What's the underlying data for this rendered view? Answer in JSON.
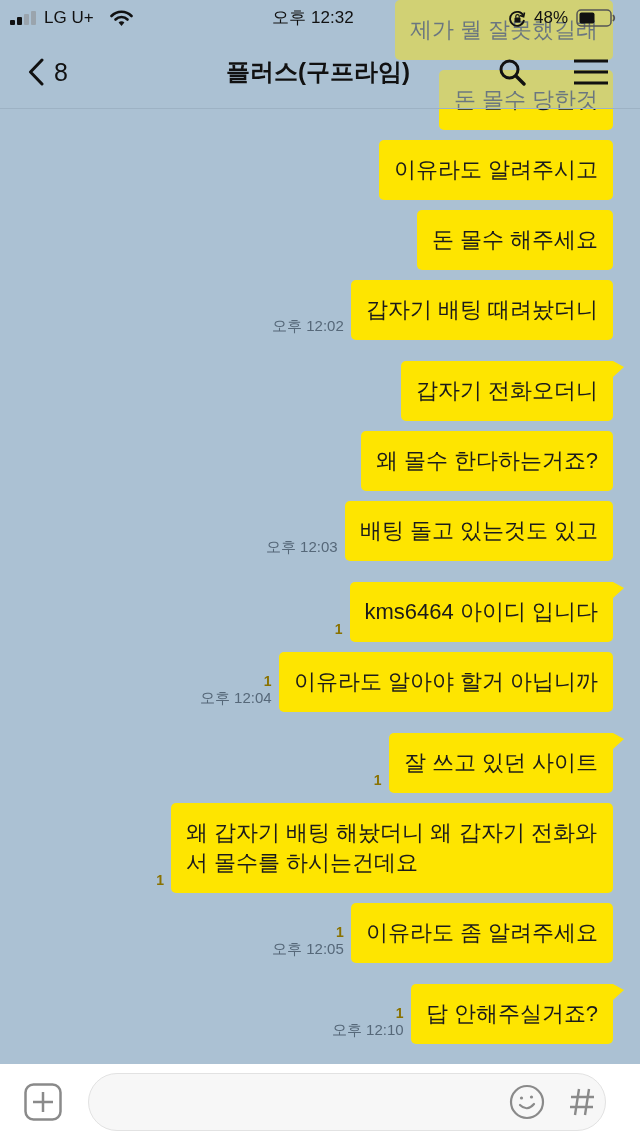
{
  "status_bar": {
    "carrier": "LG U+",
    "time": "오후 12:32",
    "battery": "48%"
  },
  "header": {
    "back_count": "8",
    "title": "플러스(구프라임)"
  },
  "messages": [
    {
      "text": "제가 뭘 잘못했길래",
      "tail": false
    },
    {
      "text": "돈 몰수 당한것",
      "tail": false
    },
    {
      "text": "이유라도 알려주시고",
      "tail": false
    },
    {
      "text": "돈 몰수 해주세요",
      "tail": false
    },
    {
      "text": "갑자기 배팅 때려놨더니",
      "tail": false,
      "time": "오후 12:02"
    },
    {
      "text": "갑자기 전화오더니",
      "tail": true
    },
    {
      "text": "왜 몰수 한다하는거죠?",
      "tail": false
    },
    {
      "text": "배팅 돌고 있는것도 있고",
      "tail": false,
      "time": "오후 12:03"
    },
    {
      "text": "kms6464 아이디 입니다",
      "tail": true,
      "unread_count": "1"
    },
    {
      "text": "이유라도 알아야 할거 아닙니까",
      "tail": false,
      "unread_count": "1",
      "time": "오후 12:04"
    },
    {
      "text": "잘 쓰고 있던 사이트",
      "tail": true,
      "unread_count": "1"
    },
    {
      "text": "왜 갑자기 배팅 해놨더니 왜 갑자기 전화와서 몰수를 하시는건데요",
      "tail": false,
      "unread_count": "1"
    },
    {
      "text": "이유라도 좀 알려주세요",
      "tail": false,
      "unread_count": "1",
      "time": "오후 12:05"
    },
    {
      "text": "답 안해주실거죠?",
      "tail": true,
      "unread_count": "1",
      "time": "오후 12:10"
    }
  ]
}
